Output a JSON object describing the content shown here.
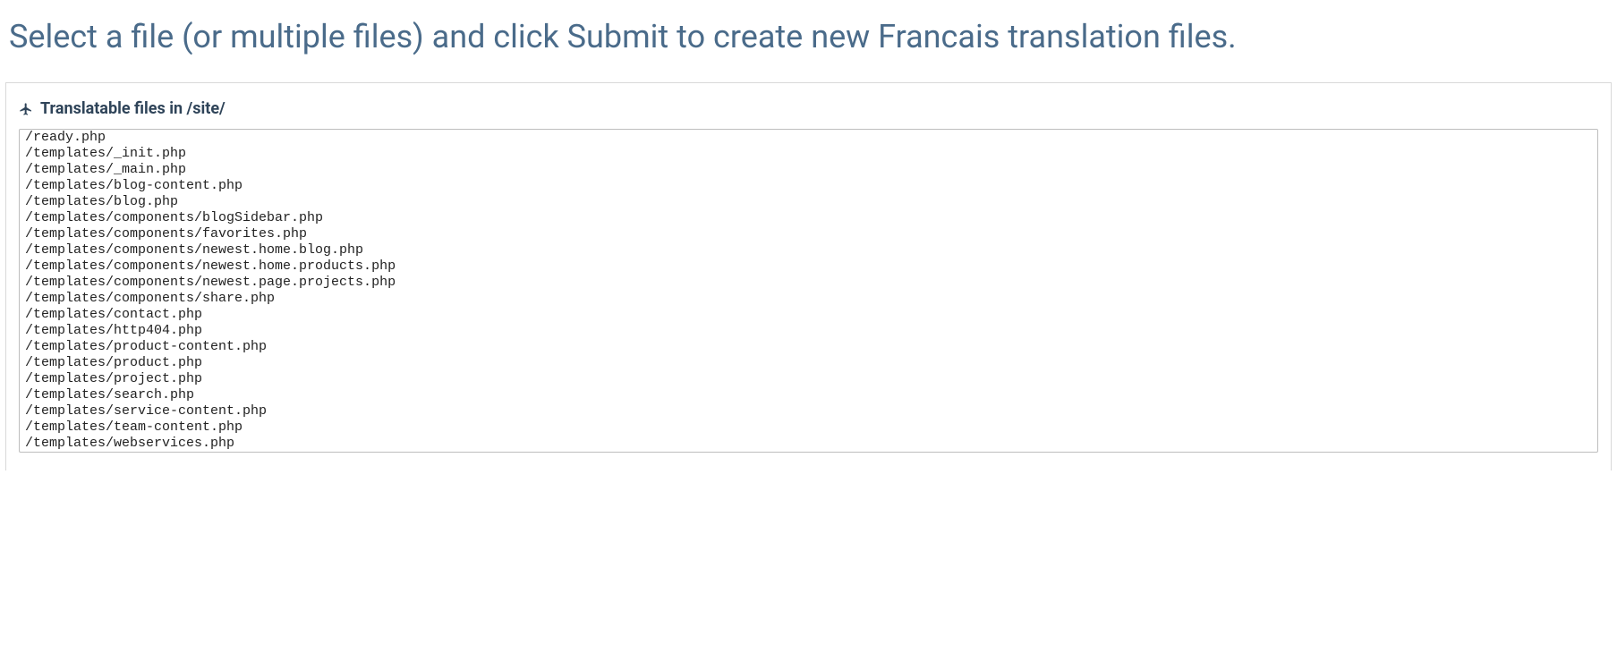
{
  "heading": "Select a file (or multiple files) and click Submit to create new Francais translation files.",
  "panel": {
    "title": "Translatable files in /site/"
  },
  "files": [
    "/ready.php",
    "/templates/_init.php",
    "/templates/_main.php",
    "/templates/blog-content.php",
    "/templates/blog.php",
    "/templates/components/blogSidebar.php",
    "/templates/components/favorites.php",
    "/templates/components/newest.home.blog.php",
    "/templates/components/newest.home.products.php",
    "/templates/components/newest.page.projects.php",
    "/templates/components/share.php",
    "/templates/contact.php",
    "/templates/http404.php",
    "/templates/product-content.php",
    "/templates/product.php",
    "/templates/project.php",
    "/templates/search.php",
    "/templates/service-content.php",
    "/templates/team-content.php",
    "/templates/webservices.php"
  ]
}
